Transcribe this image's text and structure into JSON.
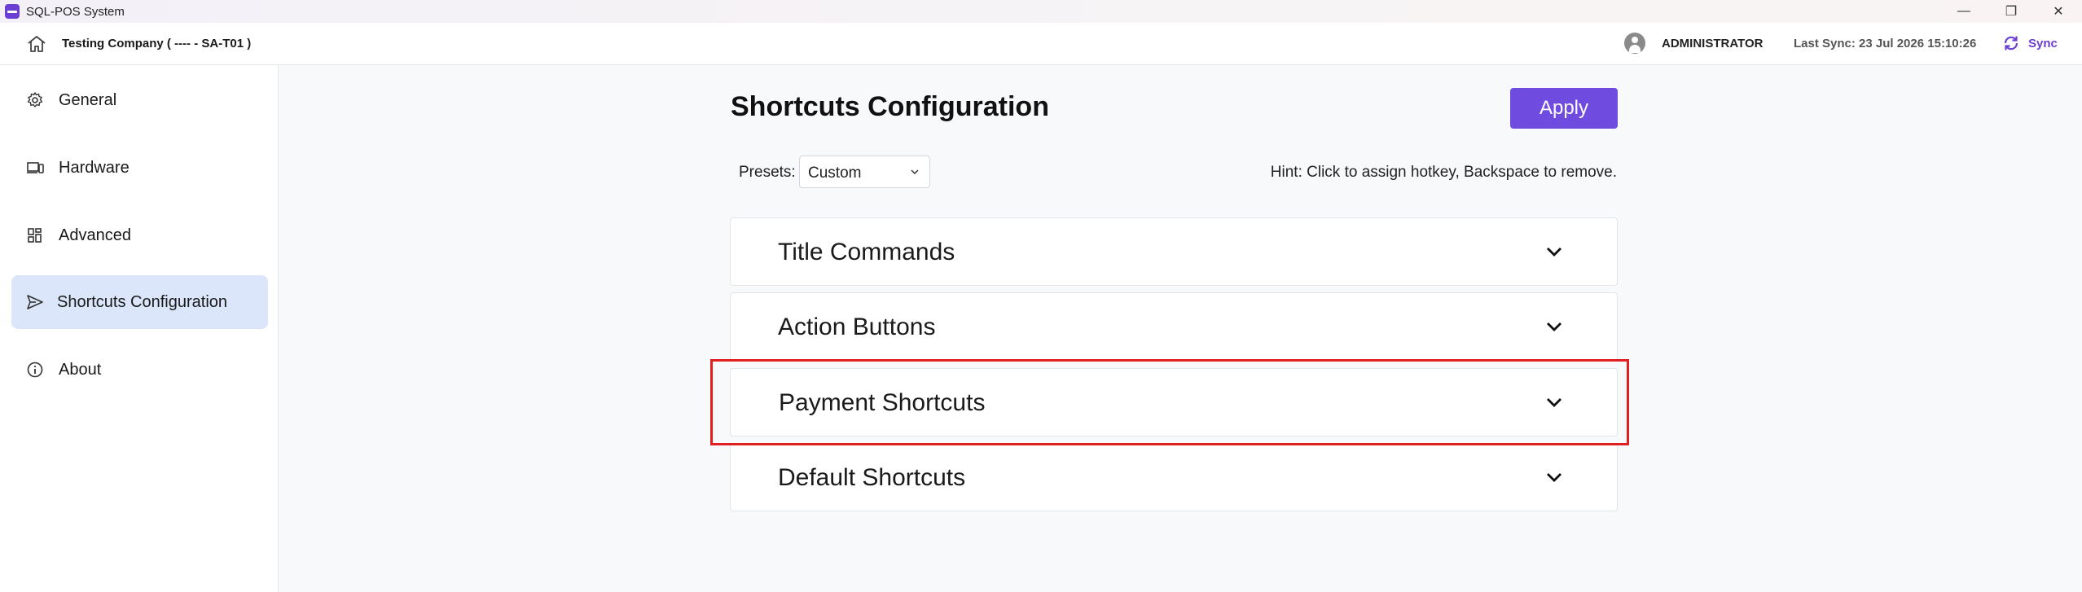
{
  "window": {
    "title": "SQL-POS System",
    "controls": {
      "minimize": "—",
      "restore": "❐",
      "close": "✕"
    }
  },
  "header": {
    "company": "Testing Company ( ---- - SA-T01 )",
    "user": "ADMINISTRATOR",
    "last_sync": "Last Sync: 23 Jul 2026 15:10:26",
    "sync_label": "Sync"
  },
  "sidebar": {
    "items": [
      {
        "label": "General",
        "icon": "gear-icon"
      },
      {
        "label": "Hardware",
        "icon": "devices-icon"
      },
      {
        "label": "Advanced",
        "icon": "grid-icon"
      },
      {
        "label": "Shortcuts Configuration",
        "icon": "send-icon",
        "active": true
      },
      {
        "label": "About",
        "icon": "info-icon"
      }
    ]
  },
  "main": {
    "title": "Shortcuts Configuration",
    "apply_label": "Apply",
    "presets_label": "Presets:",
    "presets_value": "Custom",
    "hint": "Hint: Click to assign hotkey, Backspace to remove.",
    "sections": [
      {
        "label": "Title Commands"
      },
      {
        "label": "Action Buttons"
      },
      {
        "label": "Payment Shortcuts",
        "highlighted": true
      },
      {
        "label": "Default Shortcuts"
      }
    ]
  },
  "colors": {
    "accent": "#6f4be0",
    "active_nav": "#dbe6fa",
    "highlight": "#e02020"
  }
}
